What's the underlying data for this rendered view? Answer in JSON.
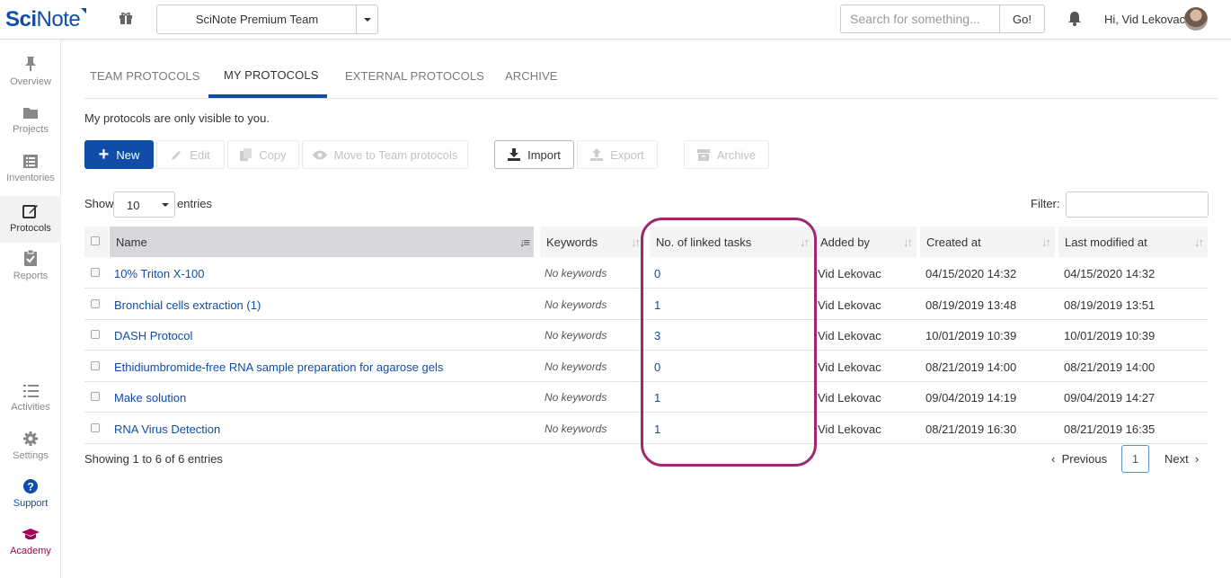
{
  "brand": {
    "logo_bold": "Sci",
    "logo_light": "Note"
  },
  "topbar": {
    "team": "SciNote Premium Team",
    "search_placeholder": "Search for something...",
    "search_button": "Go!",
    "greeting": "Hi, Vid Lekovac"
  },
  "sidebar": {
    "items": [
      {
        "label": "Overview",
        "icon": "pin-icon"
      },
      {
        "label": "Projects",
        "icon": "folder-icon"
      },
      {
        "label": "Inventories",
        "icon": "list-box-icon"
      },
      {
        "label": "Protocols",
        "icon": "edit-icon"
      },
      {
        "label": "Reports",
        "icon": "clipboard-icon"
      },
      {
        "label": "Activities",
        "icon": "list-icon"
      },
      {
        "label": "Settings",
        "icon": "gear-icon"
      },
      {
        "label": "Support",
        "icon": "question-icon"
      },
      {
        "label": "Academy",
        "icon": "graduation-cap-icon"
      }
    ]
  },
  "tabs": [
    "TEAM PROTOCOLS",
    "MY PROTOCOLS",
    "EXTERNAL PROTOCOLS",
    "ARCHIVE"
  ],
  "active_tab": "MY PROTOCOLS",
  "note": "My protocols are only visible to you.",
  "toolbar": {
    "new": "New",
    "edit": "Edit",
    "copy": "Copy",
    "move": "Move to Team protocols",
    "import": "Import",
    "export": "Export",
    "archive": "Archive"
  },
  "length": {
    "show": "Show",
    "value": "10",
    "entries": "entries"
  },
  "filter_label": "Filter:",
  "table": {
    "headers": [
      "Name",
      "Keywords",
      "No. of linked tasks",
      "Added by",
      "Created at",
      "Last modified at"
    ],
    "rows": [
      {
        "name": "10% Triton X-100",
        "keywords": "No keywords",
        "tasks": "0",
        "added_by": "Vid Lekovac",
        "created": "04/15/2020 14:32",
        "modified": "04/15/2020 14:32"
      },
      {
        "name": "Bronchial cells extraction (1)",
        "keywords": "No keywords",
        "tasks": "1",
        "added_by": "Vid Lekovac",
        "created": "08/19/2019 13:48",
        "modified": "08/19/2019 13:51"
      },
      {
        "name": "DASH Protocol",
        "keywords": "No keywords",
        "tasks": "3",
        "added_by": "Vid Lekovac",
        "created": "10/01/2019 10:39",
        "modified": "10/01/2019 10:39"
      },
      {
        "name": "Ethidiumbromide-free RNA sample preparation for agarose gels",
        "keywords": "No keywords",
        "tasks": "0",
        "added_by": "Vid Lekovac",
        "created": "08/21/2019 14:00",
        "modified": "08/21/2019 14:00"
      },
      {
        "name": "Make solution",
        "keywords": "No keywords",
        "tasks": "1",
        "added_by": "Vid Lekovac",
        "created": "09/04/2019 14:19",
        "modified": "09/04/2019 14:27"
      },
      {
        "name": "RNA Virus Detection",
        "keywords": "No keywords",
        "tasks": "1",
        "added_by": "Vid Lekovac",
        "created": "08/21/2019 16:30",
        "modified": "08/21/2019 16:35"
      }
    ]
  },
  "footer": {
    "showing": "Showing 1 to 6 of 6 entries",
    "previous": "Previous",
    "page": "1",
    "next": "Next"
  },
  "colors": {
    "brand": "#104da9",
    "highlight": "#9c2a6d",
    "academy": "#a0005b"
  }
}
